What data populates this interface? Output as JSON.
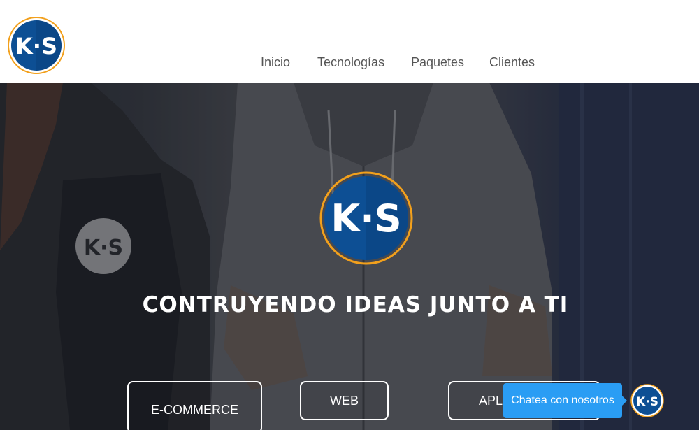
{
  "header": {
    "logo_text": "K·S",
    "nav": [
      "Inicio",
      "Tecnologías",
      "Paquetes",
      "Clientes"
    ]
  },
  "hero": {
    "logo_text": "K·S",
    "title": "CONTRUYENDO IDEAS JUNTO A TI",
    "services": [
      "E-COMMERCE",
      "WEB",
      "APL"
    ]
  },
  "chat": {
    "label": "Chatea con nosotros",
    "avatar_text": "K·S"
  },
  "colors": {
    "brand_blue": "#0d4f94",
    "brand_ring": "#f2a01c",
    "chat_blue": "#2a9df4",
    "nav_text": "#555555"
  }
}
